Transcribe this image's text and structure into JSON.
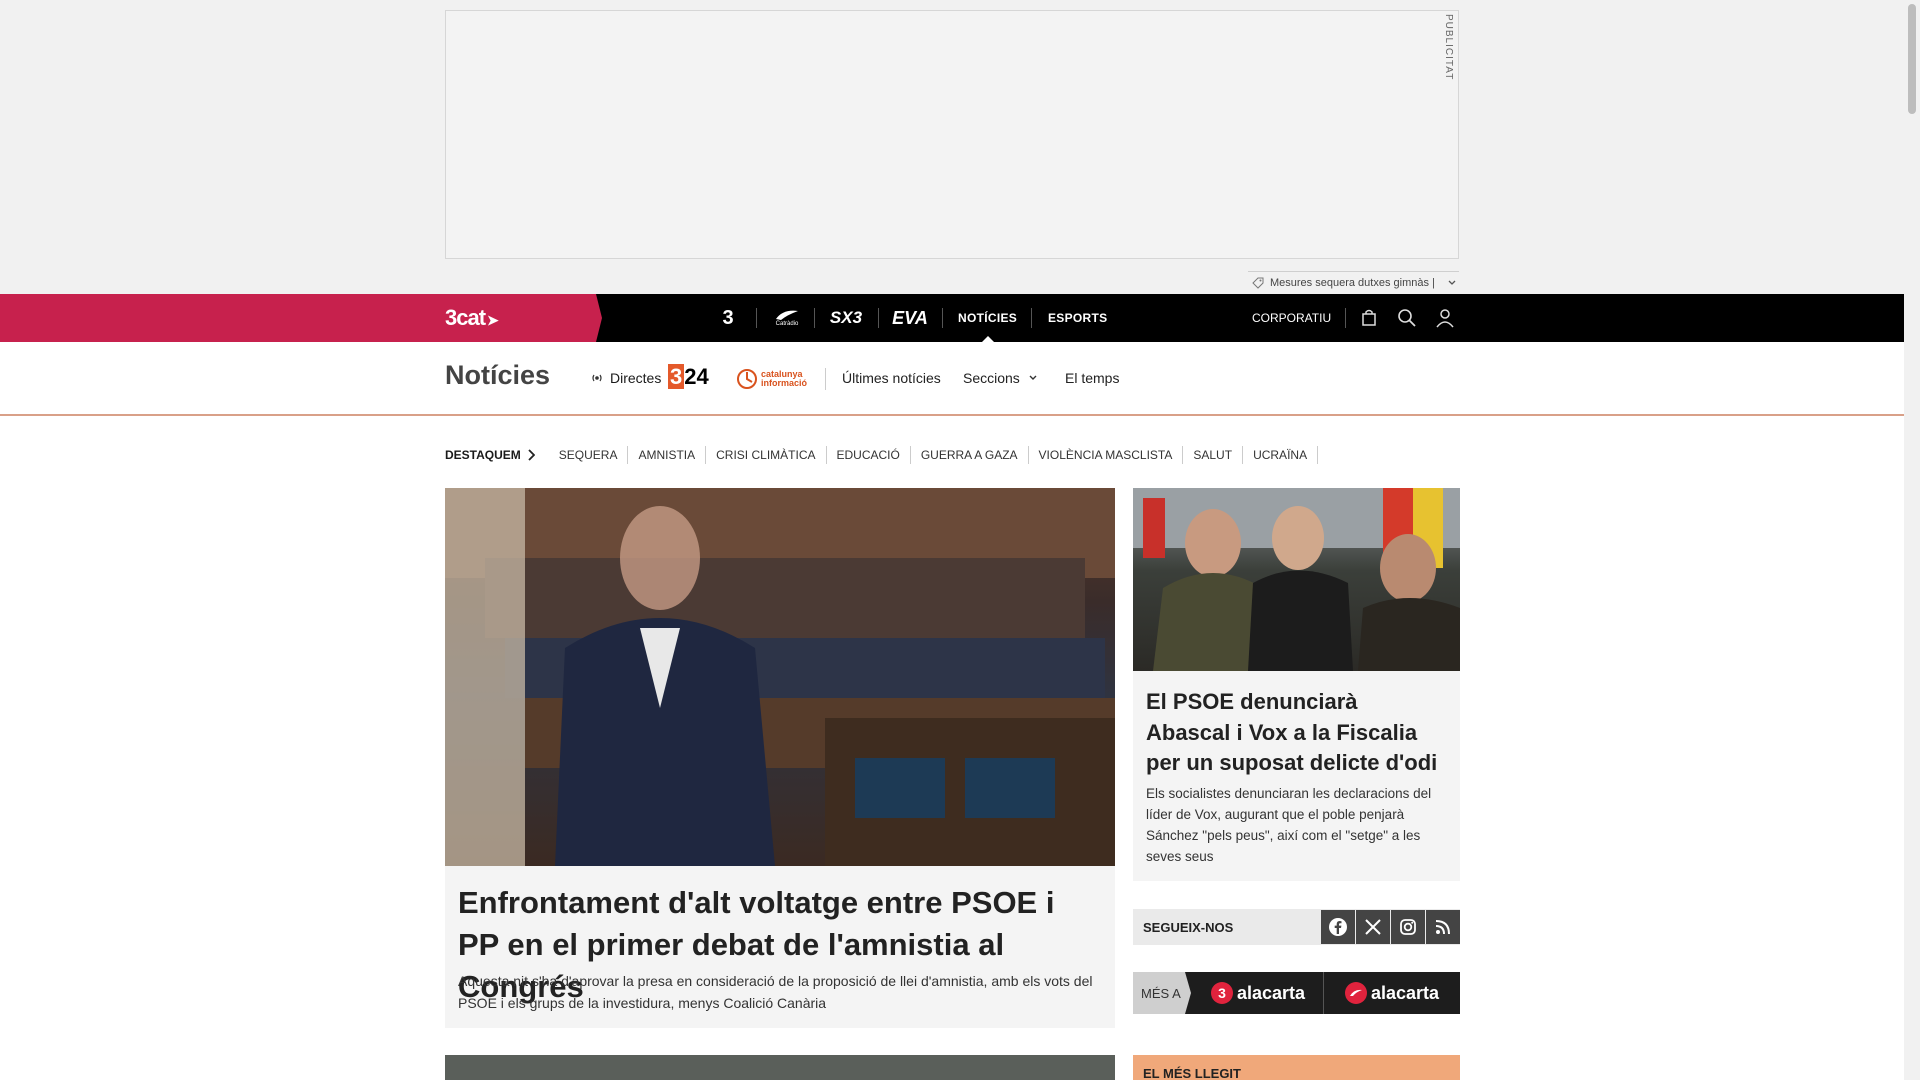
{
  "ad": {
    "label": "PUBLICITAT",
    "strip_text": "Mesures sequera dutxes gimnàs |"
  },
  "topnav": {
    "brand": "3cat",
    "channels": [
      {
        "name": "3",
        "label": "3"
      },
      {
        "name": "catradio",
        "label": "Catràdio"
      },
      {
        "name": "sx3",
        "label": "SX3"
      },
      {
        "name": "eva",
        "label": "EVA"
      }
    ],
    "links": [
      "NOTÍCIES",
      "ESPORTS"
    ],
    "corporate": "CORPORATIU"
  },
  "section": {
    "title": "Notícies",
    "directes": "Directes",
    "logo_324": "324",
    "catinfo_line1": "catalunya",
    "catinfo_line2": "informació",
    "links": [
      "Últimes notícies",
      "Seccions",
      "El temps"
    ]
  },
  "destaquem": {
    "title": "DESTAQUEM",
    "tags": [
      "SEQUERA",
      "AMNISTIA",
      "CRISI CLIMÀTICA",
      "EDUCACIÓ",
      "GUERRA A GAZA",
      "VIOLÈNCIA MASCLISTA",
      "SALUT",
      "UCRAÏNA"
    ]
  },
  "main_story": {
    "title": "Enfrontament d'alt voltatge entre PSOE i PP en el primer debat de l'amnistia al Congrés",
    "summary": "Aquesta nit s'ha d'aprovar la presa en consideració de la proposició de llei d'amnistia, amb els vots del PSOE i els grups de la investidura, menys Coalició Canària"
  },
  "side_story": {
    "title": "El PSOE denunciarà Abascal i Vox a la Fiscalia per un suposat delicte d'odi",
    "summary": "Els socialistes denunciaran les declaracions del líder de Vox, augurant que el poble penjarà Sánchez \"pels peus\", així com el \"setge\" a les seves seus"
  },
  "follow": {
    "label": "SEGUEIX-NOS",
    "networks": [
      "facebook-icon",
      "x-icon",
      "instagram-icon",
      "rss-icon"
    ]
  },
  "mesa": {
    "label": "MÉS A",
    "items": [
      "alacarta",
      "alacarta"
    ]
  },
  "llegit": {
    "label": "EL MÉS LLEGIT"
  },
  "colors": {
    "brand": "#c7214d",
    "nav_bg": "#000000",
    "accent_line": "#d9a088",
    "llegit_bg": "#f0a87a"
  }
}
